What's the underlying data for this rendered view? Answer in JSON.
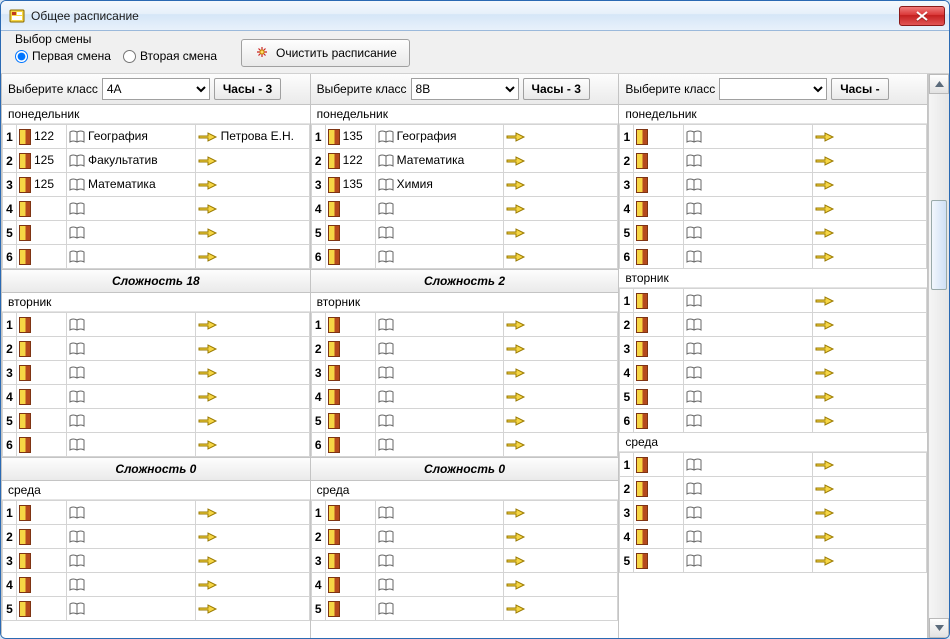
{
  "window": {
    "title": "Общее расписание"
  },
  "shift": {
    "legend": "Выбор смены",
    "first": "Первая смена",
    "second": "Вторая смена"
  },
  "clear_button": "Очистить расписание",
  "labels": {
    "choose_class": "Выберите класс",
    "hours_prefix": "Часы - "
  },
  "columns": [
    {
      "class_value": "4А",
      "hours": "3",
      "days": [
        {
          "name": "понедельник",
          "rows": [
            {
              "n": "1",
              "room": "122",
              "subject": "География",
              "teacher": "Петрова Е.Н."
            },
            {
              "n": "2",
              "room": "125",
              "subject": "Факультатив",
              "teacher": ""
            },
            {
              "n": "3",
              "room": "125",
              "subject": "Математика",
              "teacher": ""
            },
            {
              "n": "4",
              "room": "",
              "subject": "",
              "teacher": ""
            },
            {
              "n": "5",
              "room": "",
              "subject": "",
              "teacher": ""
            },
            {
              "n": "6",
              "room": "",
              "subject": "",
              "teacher": ""
            }
          ],
          "difficulty": "Сложность 18"
        },
        {
          "name": "вторник",
          "rows": [
            {
              "n": "1",
              "room": "",
              "subject": "",
              "teacher": ""
            },
            {
              "n": "2",
              "room": "",
              "subject": "",
              "teacher": ""
            },
            {
              "n": "3",
              "room": "",
              "subject": "",
              "teacher": ""
            },
            {
              "n": "4",
              "room": "",
              "subject": "",
              "teacher": ""
            },
            {
              "n": "5",
              "room": "",
              "subject": "",
              "teacher": ""
            },
            {
              "n": "6",
              "room": "",
              "subject": "",
              "teacher": ""
            }
          ],
          "difficulty": "Сложность 0"
        },
        {
          "name": "среда",
          "rows": [
            {
              "n": "1",
              "room": "",
              "subject": "",
              "teacher": ""
            },
            {
              "n": "2",
              "room": "",
              "subject": "",
              "teacher": ""
            },
            {
              "n": "3",
              "room": "",
              "subject": "",
              "teacher": ""
            },
            {
              "n": "4",
              "room": "",
              "subject": "",
              "teacher": ""
            },
            {
              "n": "5",
              "room": "",
              "subject": "",
              "teacher": ""
            }
          ],
          "difficulty": ""
        }
      ]
    },
    {
      "class_value": "8В",
      "hours": "3",
      "days": [
        {
          "name": "понедельник",
          "rows": [
            {
              "n": "1",
              "room": "135",
              "subject": "География",
              "teacher": ""
            },
            {
              "n": "2",
              "room": "122",
              "subject": "Математика",
              "teacher": ""
            },
            {
              "n": "3",
              "room": "135",
              "subject": "Химия",
              "teacher": ""
            },
            {
              "n": "4",
              "room": "",
              "subject": "",
              "teacher": ""
            },
            {
              "n": "5",
              "room": "",
              "subject": "",
              "teacher": ""
            },
            {
              "n": "6",
              "room": "",
              "subject": "",
              "teacher": ""
            }
          ],
          "difficulty": "Сложность 2"
        },
        {
          "name": "вторник",
          "rows": [
            {
              "n": "1",
              "room": "",
              "subject": "",
              "teacher": ""
            },
            {
              "n": "2",
              "room": "",
              "subject": "",
              "teacher": ""
            },
            {
              "n": "3",
              "room": "",
              "subject": "",
              "teacher": ""
            },
            {
              "n": "4",
              "room": "",
              "subject": "",
              "teacher": ""
            },
            {
              "n": "5",
              "room": "",
              "subject": "",
              "teacher": ""
            },
            {
              "n": "6",
              "room": "",
              "subject": "",
              "teacher": ""
            }
          ],
          "difficulty": "Сложность 0"
        },
        {
          "name": "среда",
          "rows": [
            {
              "n": "1",
              "room": "",
              "subject": "",
              "teacher": ""
            },
            {
              "n": "2",
              "room": "",
              "subject": "",
              "teacher": ""
            },
            {
              "n": "3",
              "room": "",
              "subject": "",
              "teacher": ""
            },
            {
              "n": "4",
              "room": "",
              "subject": "",
              "teacher": ""
            },
            {
              "n": "5",
              "room": "",
              "subject": "",
              "teacher": ""
            }
          ],
          "difficulty": ""
        }
      ]
    },
    {
      "class_value": "",
      "hours": "",
      "days": [
        {
          "name": "понедельник",
          "rows": [
            {
              "n": "1",
              "room": "",
              "subject": "",
              "teacher": ""
            },
            {
              "n": "2",
              "room": "",
              "subject": "",
              "teacher": ""
            },
            {
              "n": "3",
              "room": "",
              "subject": "",
              "teacher": ""
            },
            {
              "n": "4",
              "room": "",
              "subject": "",
              "teacher": ""
            },
            {
              "n": "5",
              "room": "",
              "subject": "",
              "teacher": ""
            },
            {
              "n": "6",
              "room": "",
              "subject": "",
              "teacher": ""
            }
          ],
          "difficulty": ""
        },
        {
          "name": "вторник",
          "rows": [
            {
              "n": "1",
              "room": "",
              "subject": "",
              "teacher": ""
            },
            {
              "n": "2",
              "room": "",
              "subject": "",
              "teacher": ""
            },
            {
              "n": "3",
              "room": "",
              "subject": "",
              "teacher": ""
            },
            {
              "n": "4",
              "room": "",
              "subject": "",
              "teacher": ""
            },
            {
              "n": "5",
              "room": "",
              "subject": "",
              "teacher": ""
            },
            {
              "n": "6",
              "room": "",
              "subject": "",
              "teacher": ""
            }
          ],
          "difficulty": ""
        },
        {
          "name": "среда",
          "rows": [
            {
              "n": "1",
              "room": "",
              "subject": "",
              "teacher": ""
            },
            {
              "n": "2",
              "room": "",
              "subject": "",
              "teacher": ""
            },
            {
              "n": "3",
              "room": "",
              "subject": "",
              "teacher": ""
            },
            {
              "n": "4",
              "room": "",
              "subject": "",
              "teacher": ""
            },
            {
              "n": "5",
              "room": "",
              "subject": "",
              "teacher": ""
            }
          ],
          "difficulty": ""
        }
      ]
    }
  ]
}
